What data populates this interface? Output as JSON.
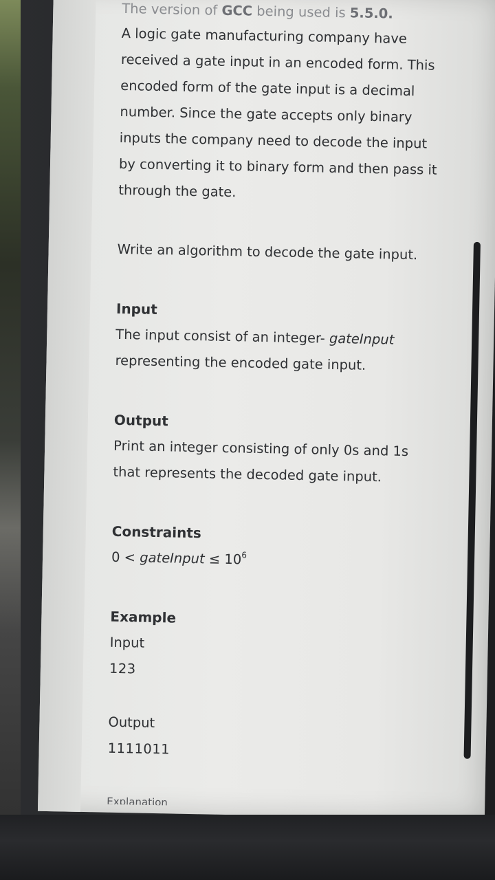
{
  "intro": {
    "gcc_prefix": "The version of ",
    "gcc_name": "GCC",
    "gcc_middle": " being used is ",
    "gcc_version": "5.5.0.",
    "lines": [
      "A logic gate manufacturing company have",
      "received a gate input in an encoded form. This",
      "encoded form of the gate input is a decimal",
      "number. Since the gate accepts only binary",
      "inputs the company need to decode the input",
      "by converting it to binary form and then pass it",
      "through the gate."
    ]
  },
  "task": "Write an algorithm to decode the gate input.",
  "input_section": {
    "heading": "Input",
    "line1_prefix": "The input consist of an integer- ",
    "line1_var": "gateInput",
    "line2": "representing the encoded gate input."
  },
  "output_section": {
    "heading": "Output",
    "line1": "Print an integer consisting of only 0s and 1s",
    "line2": "that represents the decoded gate input."
  },
  "constraints": {
    "heading": "Constraints",
    "lower": "0 < ",
    "var": "gateInput",
    "op": " ≤ ",
    "base": "10",
    "exp": "6"
  },
  "example": {
    "heading": "Example",
    "input_label": "Input",
    "input_value": "123",
    "output_label": "Output",
    "output_value": "1111011",
    "next_heading": "Explanation"
  },
  "colors": {
    "screen": "#ebebe9",
    "text": "#2f3134",
    "scrollbar": "#1c1d1f",
    "bezel": "#1d1e20"
  }
}
